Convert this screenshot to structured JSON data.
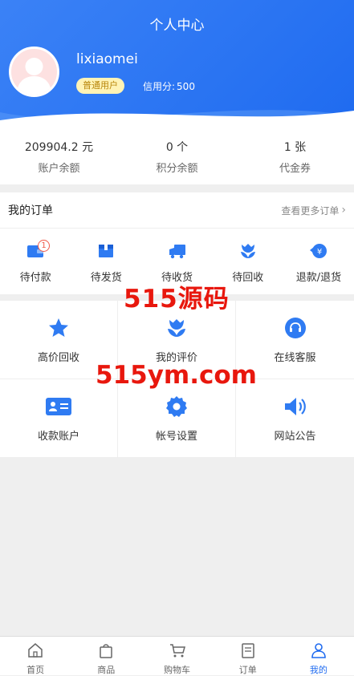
{
  "header": {
    "title": "个人中心"
  },
  "user": {
    "name": "lixiaomei",
    "badge": "普通用户",
    "credit_label": "信用分:",
    "credit_value": "500"
  },
  "stats": [
    {
      "value": "209904.2 元",
      "label": "账户余额"
    },
    {
      "value": "0 个",
      "label": "积分余额"
    },
    {
      "value": "1 张",
      "label": "代金券"
    }
  ],
  "orders": {
    "title": "我的订单",
    "more": "查看更多订单",
    "items": [
      {
        "label": "待付款",
        "icon": "wallet-icon",
        "badge": "1"
      },
      {
        "label": "待发货",
        "icon": "package-icon"
      },
      {
        "label": "待收货",
        "icon": "truck-icon"
      },
      {
        "label": "待回收",
        "icon": "tulip-icon"
      },
      {
        "label": "退款/退货",
        "icon": "refund-icon"
      }
    ]
  },
  "services": [
    {
      "label": "高价回收",
      "icon": "star-icon"
    },
    {
      "label": "我的评价",
      "icon": "tulip-icon"
    },
    {
      "label": "在线客服",
      "icon": "headset-icon"
    },
    {
      "label": "收款账户",
      "icon": "id-card-icon"
    },
    {
      "label": "帐号设置",
      "icon": "gear-icon"
    },
    {
      "label": "网站公告",
      "icon": "speaker-icon"
    }
  ],
  "watermarks": [
    "515源码",
    "515ym.com"
  ],
  "tabbar": [
    {
      "label": "首页",
      "icon": "home-icon"
    },
    {
      "label": "商品",
      "icon": "bag-icon"
    },
    {
      "label": "购物车",
      "icon": "cart-icon"
    },
    {
      "label": "订单",
      "icon": "order-icon"
    },
    {
      "label": "我的",
      "icon": "user-icon",
      "active": true
    }
  ],
  "colors": {
    "primary": "#1f6bf0",
    "badge_bg": "#fff3b5",
    "watermark": "#e8170d"
  }
}
